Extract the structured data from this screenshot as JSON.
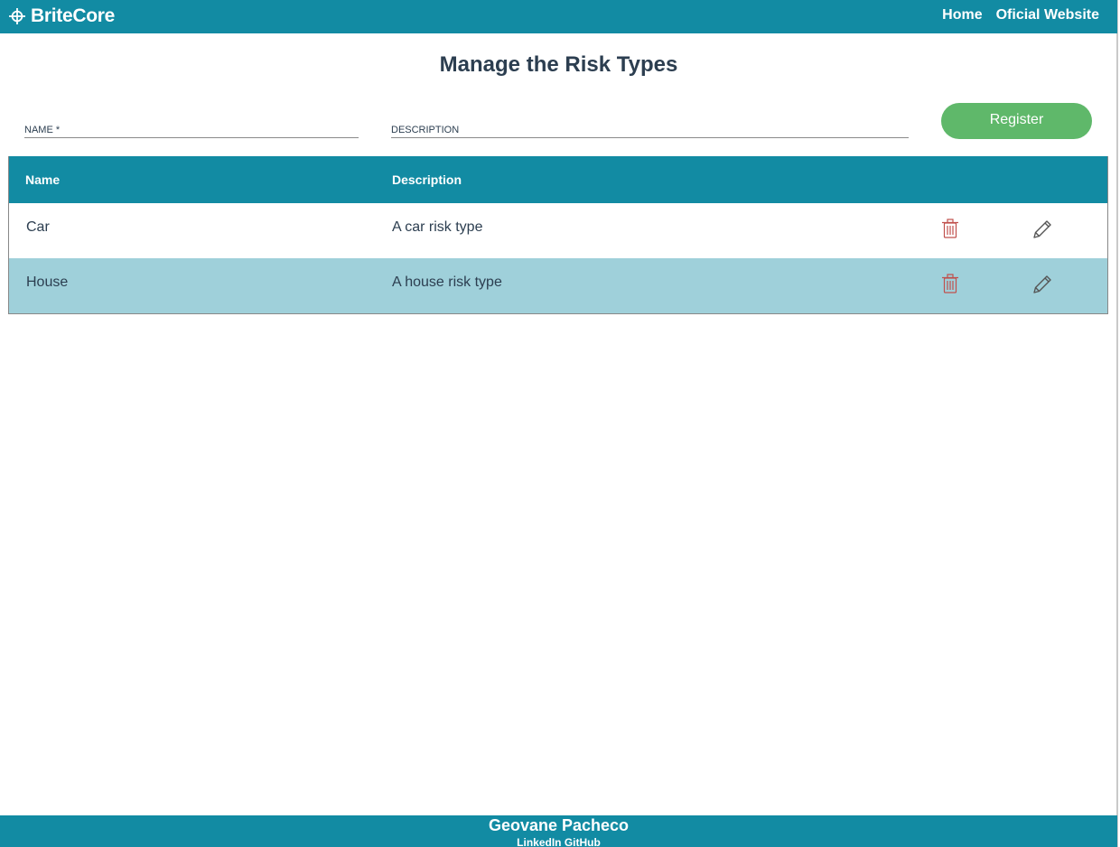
{
  "header": {
    "brand": "BriteCore",
    "nav": [
      {
        "label": "Home"
      },
      {
        "label": "Oficial Website"
      }
    ]
  },
  "main": {
    "title": "Manage the Risk Types",
    "form": {
      "name_placeholder": "NAME *",
      "name_value": "",
      "description_placeholder": "DESCRIPTION",
      "description_value": "",
      "register_label": "Register"
    },
    "table": {
      "columns": [
        "Name",
        "Description"
      ],
      "rows": [
        {
          "name": "Car",
          "description": "A car risk type"
        },
        {
          "name": "House",
          "description": "A house risk type"
        }
      ]
    }
  },
  "footer": {
    "author": "Geovane Pacheco",
    "links": [
      "LinkedIn",
      "GitHub"
    ]
  },
  "colors": {
    "primary": "#128ba3",
    "register": "#5fb86a",
    "row_alt": "#9fd0da",
    "text": "#2c3e50",
    "delete_icon": "#c0504d"
  }
}
